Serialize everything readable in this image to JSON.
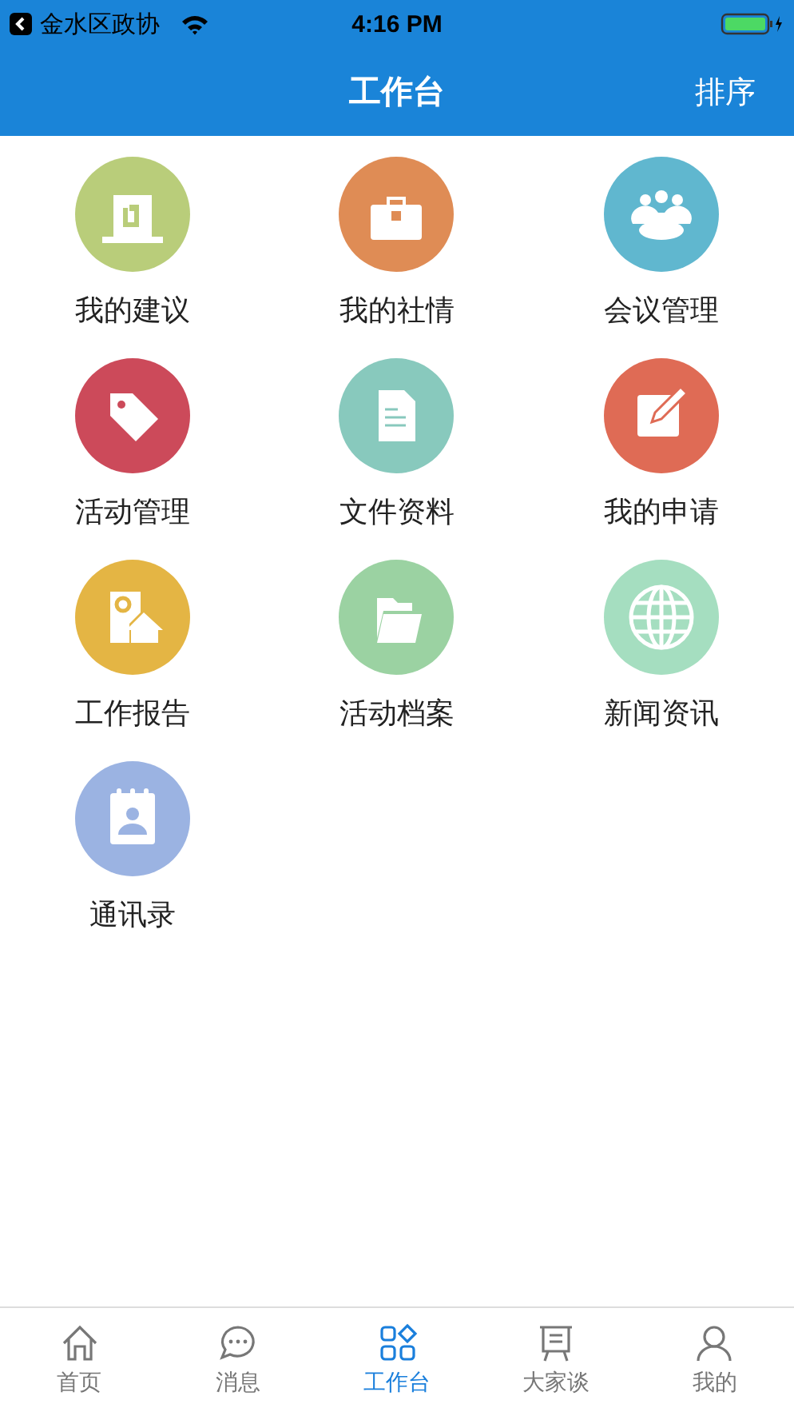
{
  "status_bar": {
    "carrier": "金水区政协",
    "time": "4:16 PM"
  },
  "nav_bar": {
    "title": "工作台",
    "action": "排序"
  },
  "apps": [
    {
      "label": "我的建议",
      "color": "#b9cd7a"
    },
    {
      "label": "我的社情",
      "color": "#df8c55"
    },
    {
      "label": "会议管理",
      "color": "#60b7cf"
    },
    {
      "label": "活动管理",
      "color": "#cc4a5a"
    },
    {
      "label": "文件资料",
      "color": "#88c9bd"
    },
    {
      "label": "我的申请",
      "color": "#df6b55"
    },
    {
      "label": "工作报告",
      "color": "#e4b544"
    },
    {
      "label": "活动档案",
      "color": "#9bd2a2"
    },
    {
      "label": "新闻资讯",
      "color": "#a5dec0"
    },
    {
      "label": "通讯录",
      "color": "#9bb3e2"
    }
  ],
  "tab_bar": [
    {
      "label": "首页",
      "selected": false
    },
    {
      "label": "消息",
      "selected": false
    },
    {
      "label": "工作台",
      "selected": true
    },
    {
      "label": "大家谈",
      "selected": false
    },
    {
      "label": "我的",
      "selected": false
    }
  ]
}
